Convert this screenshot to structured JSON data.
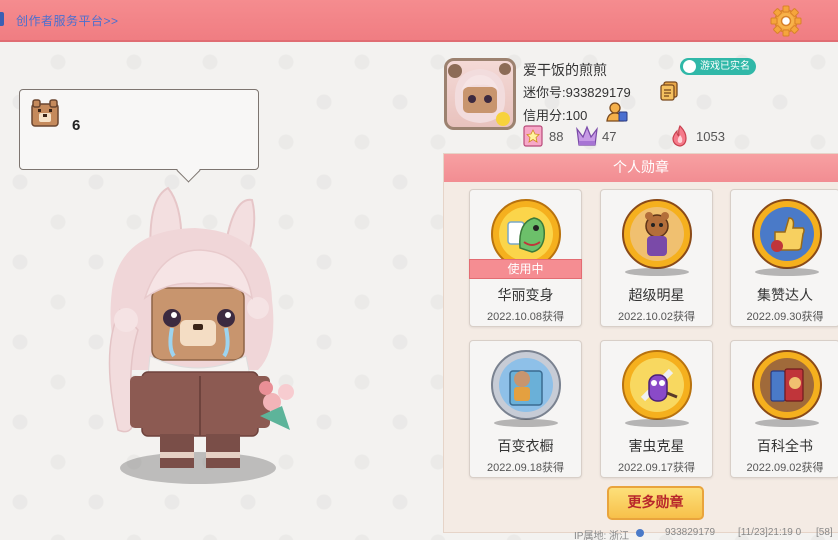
{
  "topbar": {
    "creator_link": "创作者服务平台>>",
    "accent": "#f07d82"
  },
  "bubble": {
    "count": "6"
  },
  "profile": {
    "nickname": "爱干饭的煎煎",
    "realname_badge": "游戏已实名",
    "mini_id": "迷你号:933829179",
    "credit": "信用分:100",
    "stats": {
      "likes": "88",
      "followers": "47",
      "popularity": "1053"
    }
  },
  "badges": {
    "title": "个人勋章",
    "in_use_label": "使用中",
    "items": [
      {
        "name": "华丽变身",
        "date": "2022.10.08获得",
        "icon": "dino-medal-icon"
      },
      {
        "name": "超级明星",
        "date": "2022.10.02获得",
        "icon": "star-medal-icon"
      },
      {
        "name": "集赞达人",
        "date": "2022.09.30获得",
        "icon": "thumbs-up-medal-icon"
      },
      {
        "name": "百变衣橱",
        "date": "2022.09.18获得",
        "icon": "wardrobe-medal-icon"
      },
      {
        "name": "害虫克星",
        "date": "2022.09.17获得",
        "icon": "bug-medal-icon"
      },
      {
        "name": "百科全书",
        "date": "2022.09.02获得",
        "icon": "book-medal-icon"
      }
    ],
    "more_button": "更多勋章"
  },
  "footer": {
    "ip": "IP属地: 浙江",
    "id": "933829179",
    "time": "[11/23]21:19 0",
    "extra": "[58]"
  }
}
